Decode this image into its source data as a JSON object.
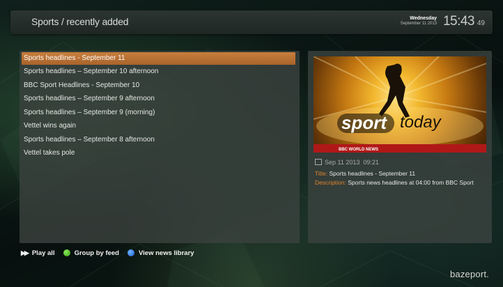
{
  "header": {
    "title": "Sports / recently added",
    "day": "Wednesday",
    "date": "September 11 2013",
    "time": "15:43",
    "seconds": "49"
  },
  "list": {
    "items": [
      {
        "label": "Sports headlines - September 11",
        "selected": true
      },
      {
        "label": "Sports headlines – September 10 afternoon",
        "selected": false
      },
      {
        "label": "BBC Sport Headlines - September 10",
        "selected": false
      },
      {
        "label": "Sports headlines – September 9 afternoon",
        "selected": false
      },
      {
        "label": "Sports headlines – September 9 (morning)",
        "selected": false
      },
      {
        "label": "Vettel wins again",
        "selected": false
      },
      {
        "label": "Sports headlines – September 8 afternoon",
        "selected": false
      },
      {
        "label": "Vettel takes pole",
        "selected": false
      }
    ]
  },
  "detail": {
    "thumbnail": {
      "brand_sport": "sport",
      "brand_today": "today",
      "channel": "BBC WORLD NEWS"
    },
    "date": "Sep 11 2013",
    "time": "09:21",
    "title_key": "Title:",
    "title_value": "Sports headlines - September 11",
    "description_key": "Description:",
    "description_value": "Sports news headlines at 04:00 from BBC Sport"
  },
  "footer": {
    "play_all": "Play all",
    "group_by_feed": "Group by feed",
    "view_news_library": "View news library"
  },
  "brand": "bazeport.",
  "colors": {
    "accent_orange": "#c87e3c",
    "key_orange": "#e0832c",
    "green_button": "#3aa214",
    "blue_button": "#1c5fd1"
  }
}
